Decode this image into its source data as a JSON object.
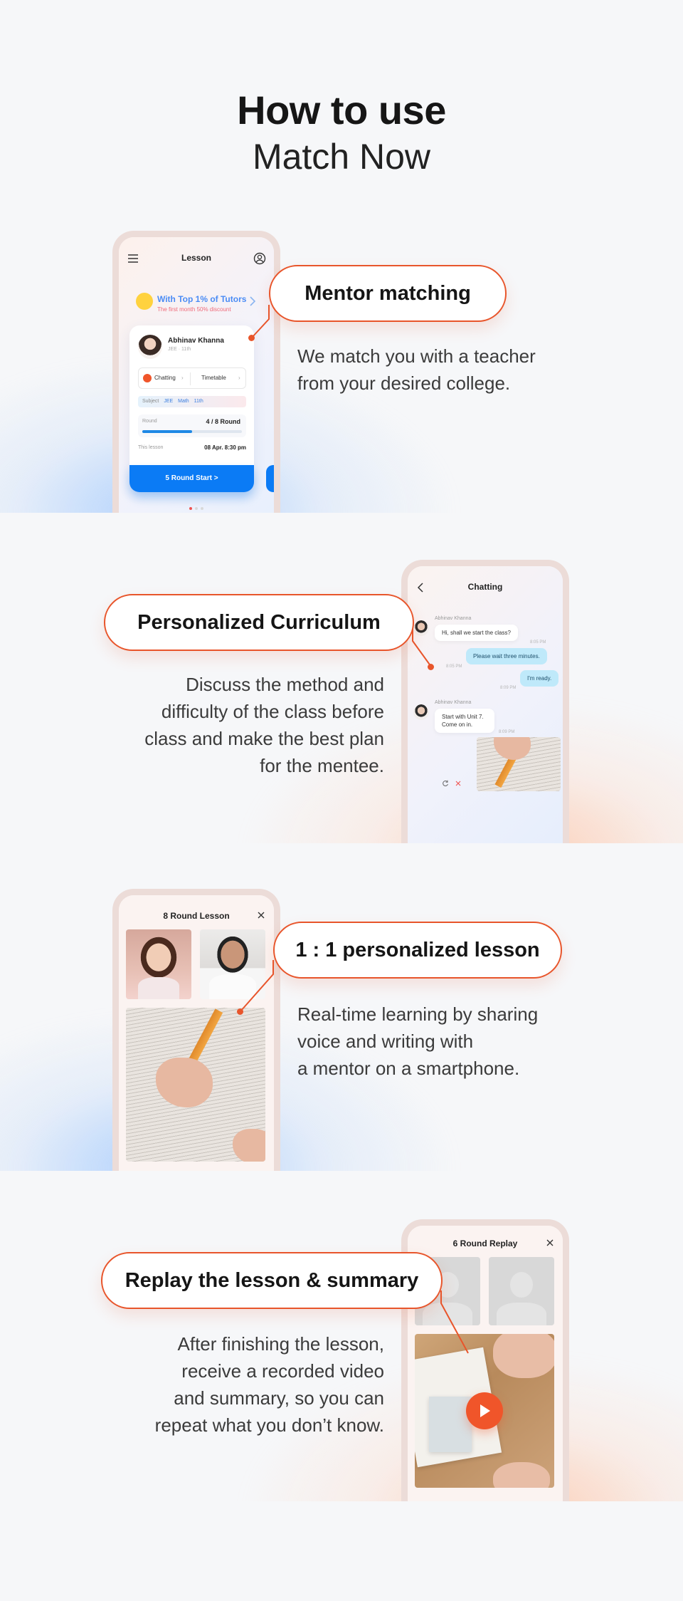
{
  "page": {
    "title_line1": "How to use",
    "title_line2": "Match Now"
  },
  "colors": {
    "accent": "#e8552b",
    "primary_blue": "#0b7bf5",
    "background": "#f6f7f9"
  },
  "sections": [
    {
      "callout": "Mentor matching",
      "description": [
        "We match you with a teacher",
        "from your desired college."
      ]
    },
    {
      "callout": "Personalized Curriculum",
      "description": [
        "Discuss the method and",
        "difficulty of the class before",
        "class and make the best plan",
        "for the mentee."
      ]
    },
    {
      "callout": "1 : 1 personalized lesson",
      "description": [
        "Real-time learning by sharing",
        "voice and writing with",
        "a mentor on a smartphone."
      ]
    },
    {
      "callout": "Replay the lesson & summary",
      "description": [
        "After finishing the lesson,",
        "receive a recorded video",
        "and summary, so you can",
        "repeat what you don’t know."
      ]
    }
  ],
  "lesson_screen": {
    "title": "Lesson",
    "menu_icon": "hamburger-menu-icon",
    "profile_icon": "user-circle-icon",
    "promo_title": "With Top 1% of Tutors",
    "promo_subtitle": "The first month 50% discount",
    "mentor_name": "Abhinav Khanna",
    "mentor_tags": "JEE · 11th",
    "chatting_label": "Chatting",
    "timetable_label": "Timetable",
    "subject_label": "Subject",
    "subjects": [
      "JEE",
      "Math",
      "11th"
    ],
    "round_label": "Round",
    "round_value": "4 / 8 Round",
    "round_progress": 0.5,
    "lesson_label": "This lesson",
    "lesson_value": "08 Apr. 8:30 pm",
    "start_button": "5 Round Start >",
    "carousel_active": 0
  },
  "chat_screen": {
    "title": "Chatting",
    "sender_name": "Abhinav Khanna",
    "messages": [
      {
        "text": "Hi, shall we start the class?",
        "time": "8:05 PM"
      },
      {
        "text": "Please wait three minutes.",
        "time": "8:05 PM"
      },
      {
        "text": "I'm ready.",
        "time": "8:09 PM"
      },
      {
        "text": "Start with Unit 7. Come on in.",
        "time": "8:09 PM"
      }
    ]
  },
  "lesson_video_screen": {
    "title": "8 Round Lesson"
  },
  "replay_screen": {
    "title": "6 Round Replay"
  }
}
